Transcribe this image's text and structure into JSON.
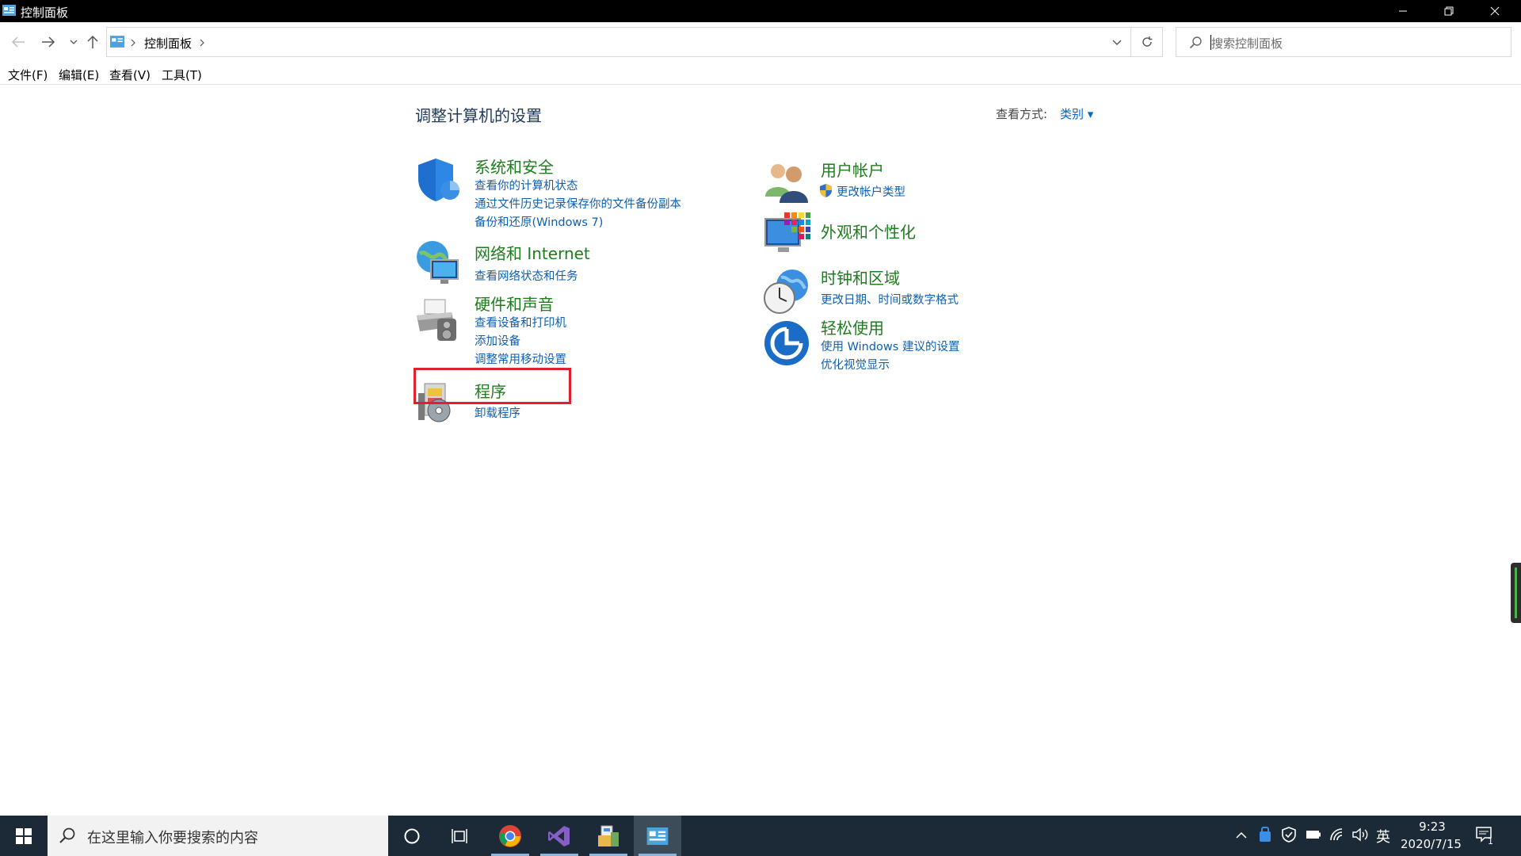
{
  "window": {
    "title": "控制面板"
  },
  "address": {
    "breadcrumb": "控制面板",
    "search_placeholder": "搜索控制面板"
  },
  "menu": [
    "文件(F)",
    "编辑(E)",
    "查看(V)",
    "工具(T)"
  ],
  "content": {
    "heading": "调整计算机的设置",
    "view_by_label": "查看方式:",
    "view_by_value": "类别 ▾",
    "left_categories": [
      {
        "title": "系统和安全",
        "links": [
          "查看你的计算机状态",
          "通过文件历史记录保存你的文件备份副本",
          "备份和还原(Windows 7)"
        ]
      },
      {
        "title": "网络和 Internet",
        "links": [
          "查看网络状态和任务"
        ]
      },
      {
        "title": "硬件和声音",
        "links": [
          "查看设备和打印机",
          "添加设备",
          "调整常用移动设置"
        ]
      },
      {
        "title": "程序",
        "links": [
          "卸载程序"
        ]
      }
    ],
    "right_categories": [
      {
        "title": "用户帐户",
        "links": [
          "更改帐户类型"
        ]
      },
      {
        "title": "外观和个性化",
        "links": []
      },
      {
        "title": "时钟和区域",
        "links": [
          "更改日期、时间或数字格式"
        ]
      },
      {
        "title": "轻松使用",
        "links": [
          "使用 Windows 建议的设置",
          "优化视觉显示"
        ]
      }
    ]
  },
  "taskbar": {
    "search_placeholder": "在这里输入你要搜索的内容",
    "apps": [
      "chrome-icon",
      "visual-studio-icon",
      "file-explorer-icon",
      "control-panel-icon"
    ],
    "ime": "英",
    "time": "9:23",
    "date": "2020/7/15",
    "notification_count": "1"
  }
}
